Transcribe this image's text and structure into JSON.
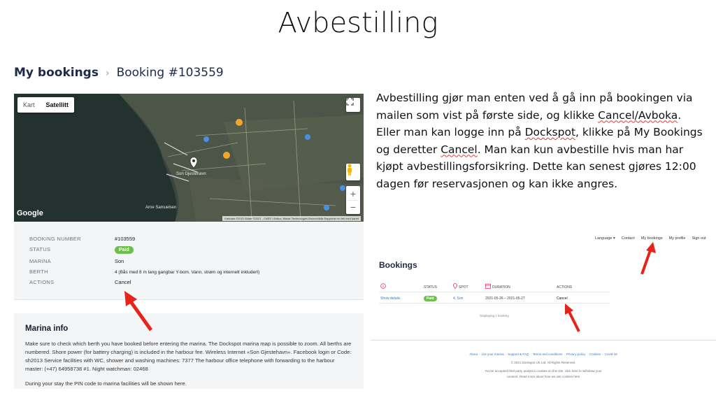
{
  "slide": {
    "title": "Avbestilling"
  },
  "breadcrumb": {
    "root": "My bookings",
    "separator": "›",
    "current": "Booking #103559"
  },
  "map": {
    "toggle": [
      "Kart",
      "Satellitt"
    ],
    "active_toggle": "Satellitt",
    "logo": "Google",
    "attribution": "Kartdata ©2021 Bilder ©2021 , CNES / Airbus, Maxar Technologies   Brukervilkår   Rapporter en feil med kartet",
    "places": [
      "Son Gjestehavn",
      "Arne Samuelsen"
    ],
    "zoom_in": "+",
    "zoom_out": "−"
  },
  "details": {
    "booking_number_label": "BOOKING NUMBER",
    "booking_number": "#103559",
    "status_label": "STATUS",
    "status": "Paid",
    "marina_label": "MARINA",
    "marina": "Son",
    "berth_label": "BERTH",
    "berth": "4 (Bås med 8 m lang gangbar Y-bom. Vann, strøm og internett inkludert)",
    "actions_label": "ACTIONS",
    "cancel": "Cancel"
  },
  "marina_info": {
    "title": "Marina info",
    "paragraph1": "Make sure to check which berth you have booked before entering the marina. The Dockspot marina map is possible to zoom. All berths are numbered. Shore power (for battery charging) is included in the harbour fee. Wireless Internet «Son Gjestehavn». Facebook login or Code: sh2013 Service facilities with WC, shower and washing machines: 7377 The harbour office telephone with forwarding to the harbour master: (+47) 64958738 #1. Night watchman: 02468",
    "paragraph2": "During your stay the PIN code to marina facilities will be shown here."
  },
  "explanation": {
    "p1": "Avbestilling gjør man enten ved å gå inn på bookingen via mailen som vist på første side, og klikke ",
    "cancel_avboka": "Cancel/Avboka",
    "p2": ". Eller man kan logge inn på ",
    "dockspot": "Dockspot",
    "p3": ", klikke på My Bookings og deretter ",
    "cancel": "Cancel",
    "p4": ". Man kan kun avbestille hvis man har kjøpt avbestillingsforsikring. Dette kan senest gjøres 12:00 dagen før reservasjonen og kan ikke angres."
  },
  "mini": {
    "nav": [
      "Language ▾",
      "Contact",
      "My bookings",
      "My profile",
      "Sign out"
    ],
    "title": "Bookings",
    "headers": {
      "status": "STATUS",
      "spot": "SPOT",
      "duration": "DURATION",
      "actions": "ACTIONS"
    },
    "row": {
      "show": "Show details",
      "status": "Paid",
      "spot": "4, Son",
      "duration": "2021-05-26 – 2021-05-27",
      "action": "Cancel"
    },
    "count": "Displaying 1 booking",
    "footer_links": [
      "About",
      "List your marina",
      "Support & FAQ",
      "Terms and conditions",
      "Privacy policy",
      "Cookies",
      "Covid-19"
    ],
    "copyright": "© 2021 Dockspot UK Ltd. All Rights Reserved.",
    "cookie_line1": "You've accepted third party analytics cookies on this site, click here to withdraw your",
    "cookie_line2": "consent. Read more about how we use cookies here"
  },
  "colors": {
    "accent": "#2a7be4",
    "paid": "#6cc04a",
    "arrow": "#e8231b",
    "navy": "#1e2a4a"
  }
}
